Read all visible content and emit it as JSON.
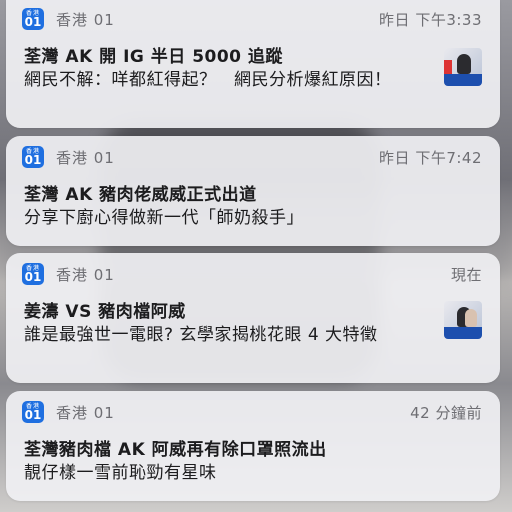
{
  "notifications": [
    {
      "app_name": "香港 01",
      "time": "昨日 下午3:33",
      "title": "荃灣 AK 開 IG 半日 5000 追蹤",
      "body": "網民不解：咩都紅得起？　網民分析爆紅原因！",
      "has_thumbnail": true
    },
    {
      "app_name": "香港 01",
      "time": "昨日 下午7:42",
      "title": "荃灣 AK 豬肉佬威威正式出道",
      "body": "分享下廚心得做新一代「師奶殺手」",
      "has_thumbnail": false
    },
    {
      "app_name": "香港 01",
      "time": "現在",
      "title": "姜濤 VS 豬肉檔阿威",
      "body": "誰是最強世一電眼? 玄學家揭桃花眼 4 大特徵",
      "has_thumbnail": true
    },
    {
      "app_name": "香港 01",
      "time": "42 分鐘前",
      "title": "荃灣豬肉檔 AK 阿威再有除口罩照流出",
      "body": "靚仔樣一雪前恥勁有星味",
      "has_thumbnail": false
    }
  ],
  "app_icon": {
    "top_text": "香港",
    "number": "01",
    "color": "#1f6fe0"
  },
  "icons": [
    "app-icon",
    "thumbnail-image"
  ]
}
